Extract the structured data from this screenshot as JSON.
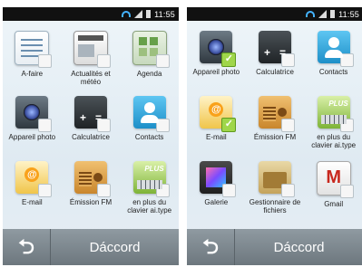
{
  "status_bar": {
    "time": "11:55"
  },
  "left_screen": {
    "apps": [
      {
        "label": "A-faire",
        "icon": "todo-icon",
        "selected": false
      },
      {
        "label": "Actualités et météo",
        "icon": "news-icon",
        "selected": false
      },
      {
        "label": "Agenda",
        "icon": "calendar-icon",
        "selected": false
      },
      {
        "label": "Appareil photo",
        "icon": "camera-icon",
        "selected": false
      },
      {
        "label": "Calculatrice",
        "icon": "calculator-icon",
        "selected": false
      },
      {
        "label": "Contacts",
        "icon": "contacts-icon",
        "selected": false
      },
      {
        "label": "E-mail",
        "icon": "email-icon",
        "selected": false
      },
      {
        "label": "Émission FM",
        "icon": "radio-icon",
        "selected": false
      },
      {
        "label": "en plus du clavier ai.type",
        "icon": "keyboard-plus-icon",
        "selected": false
      }
    ],
    "bottom_bar": {
      "ok_label": "Dáccord",
      "back_icon": "back-icon"
    }
  },
  "right_screen": {
    "apps": [
      {
        "label": "Appareil photo",
        "icon": "camera-icon",
        "selected": true
      },
      {
        "label": "Calculatrice",
        "icon": "calculator-icon",
        "selected": false
      },
      {
        "label": "Contacts",
        "icon": "contacts-icon",
        "selected": false
      },
      {
        "label": "E-mail",
        "icon": "email-icon",
        "selected": true
      },
      {
        "label": "Émission FM",
        "icon": "radio-icon",
        "selected": false
      },
      {
        "label": "en plus du clavier ai.type",
        "icon": "keyboard-plus-icon",
        "selected": false
      },
      {
        "label": "Galerie",
        "icon": "gallery-icon",
        "selected": false
      },
      {
        "label": "Gestionnaire de fichiers",
        "icon": "file-manager-icon",
        "selected": false
      },
      {
        "label": "Gmail",
        "icon": "gmail-icon",
        "selected": false
      }
    ],
    "bottom_bar": {
      "ok_label": "Dáccord",
      "back_icon": "back-icon"
    }
  },
  "colors": {
    "check_badge": "#9fd64a",
    "bottom_bar": "#7f8990",
    "status_bar": "#111111"
  }
}
